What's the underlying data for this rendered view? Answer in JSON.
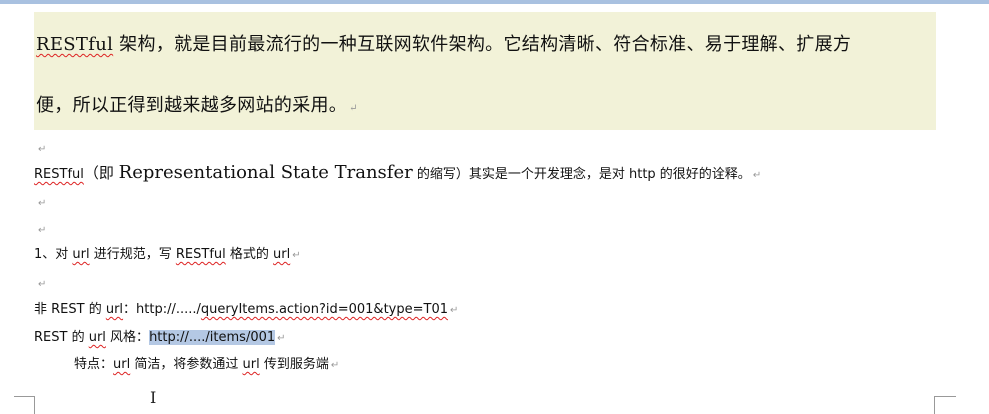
{
  "document": {
    "para1": {
      "term": "RESTful",
      "line1_rest": " 架构，就是目前最流行的一种互联网软件架构。它结构清晰、符合标准、易于理解、扩展方",
      "line2": "便，所以正得到越来越多网站的采用。"
    },
    "para2": {
      "term": "RESTful",
      "open": "（即 ",
      "expansion": "Representational State Transfer",
      "close": " 的缩写）其实是一个开发理念，是对 http 的很好的诠释。"
    },
    "item1": {
      "prefix": "1、对 ",
      "url1": "url",
      "mid": " 进行规范，写 ",
      "term": "RESTful",
      "mid2": " 格式的 ",
      "url2": "url"
    },
    "nonrest": {
      "prefix": "非 REST 的 ",
      "url": "url",
      "colon": "：http://...../",
      "path": "queryItems.action?id=001&type=T01"
    },
    "rest": {
      "prefix": "REST 的 ",
      "url": "url",
      "style": " 风格：",
      "selected": "http://..../items/001"
    },
    "feature": {
      "prefix": "特点：",
      "url1": "url",
      "mid": " 简洁，将参数通过 ",
      "url2": "url",
      "end": " 传到服务端"
    },
    "para_mark": "↵",
    "cursor": "I"
  },
  "colors": {
    "highlight": "#f2f2d8",
    "selection": "#b4c8e4",
    "spellcheck": "#d22"
  }
}
